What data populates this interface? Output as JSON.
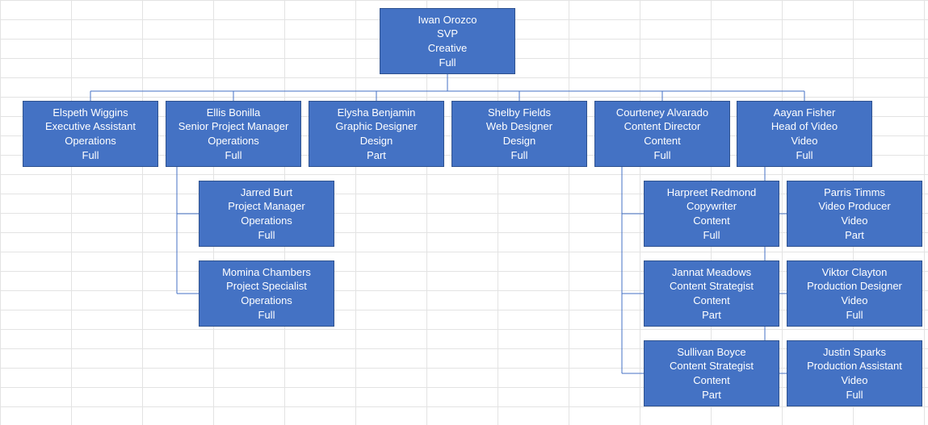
{
  "colors": {
    "node_fill": "#4472c4",
    "node_border": "#2f528f",
    "text": "#ffffff",
    "grid": "#e3e3e3"
  },
  "root": {
    "name": "Iwan Orozco",
    "title": "SVP",
    "dept": "Creative",
    "status": "Full"
  },
  "row2": [
    {
      "name": "Elspeth Wiggins",
      "title": "Executive Assistant",
      "dept": "Operations",
      "status": "Full"
    },
    {
      "name": "Ellis Bonilla",
      "title": "Senior Project Manager",
      "dept": "Operations",
      "status": "Full"
    },
    {
      "name": "Elysha Benjamin",
      "title": "Graphic Designer",
      "dept": "Design",
      "status": "Part"
    },
    {
      "name": "Shelby Fields",
      "title": "Web Designer",
      "dept": "Design",
      "status": "Full"
    },
    {
      "name": "Courteney Alvarado",
      "title": "Content Director",
      "dept": "Content",
      "status": "Full"
    },
    {
      "name": "Aayan Fisher",
      "title": "Head of Video",
      "dept": "Video",
      "status": "Full"
    }
  ],
  "ellis_children": [
    {
      "name": "Jarred Burt",
      "title": "Project Manager",
      "dept": "Operations",
      "status": "Full"
    },
    {
      "name": "Momina Chambers",
      "title": "Project Specialist",
      "dept": "Operations",
      "status": "Full"
    }
  ],
  "courteney_children": [
    {
      "name": "Harpreet Redmond",
      "title": "Copywriter",
      "dept": "Content",
      "status": "Full"
    },
    {
      "name": "Jannat Meadows",
      "title": "Content Strategist",
      "dept": "Content",
      "status": "Part"
    },
    {
      "name": "Sullivan Boyce",
      "title": "Content Strategist",
      "dept": "Content",
      "status": "Part"
    }
  ],
  "aayan_children": [
    {
      "name": "Parris Timms",
      "title": "Video Producer",
      "dept": "Video",
      "status": "Part"
    },
    {
      "name": "Viktor Clayton",
      "title": "Production Designer",
      "dept": "Video",
      "status": "Full"
    },
    {
      "name": "Justin Sparks",
      "title": "Production Assistant",
      "dept": "Video",
      "status": "Full"
    }
  ],
  "chart_data": {
    "type": "tree",
    "title": "",
    "root": {
      "name": "Iwan Orozco",
      "title": "SVP",
      "dept": "Creative",
      "status": "Full",
      "children": [
        {
          "name": "Elspeth Wiggins",
          "title": "Executive Assistant",
          "dept": "Operations",
          "status": "Full",
          "children": []
        },
        {
          "name": "Ellis Bonilla",
          "title": "Senior Project Manager",
          "dept": "Operations",
          "status": "Full",
          "children": [
            {
              "name": "Jarred Burt",
              "title": "Project Manager",
              "dept": "Operations",
              "status": "Full",
              "children": []
            },
            {
              "name": "Momina Chambers",
              "title": "Project Specialist",
              "dept": "Operations",
              "status": "Full",
              "children": []
            }
          ]
        },
        {
          "name": "Elysha Benjamin",
          "title": "Graphic Designer",
          "dept": "Design",
          "status": "Part",
          "children": []
        },
        {
          "name": "Shelby Fields",
          "title": "Web Designer",
          "dept": "Design",
          "status": "Full",
          "children": []
        },
        {
          "name": "Courteney Alvarado",
          "title": "Content Director",
          "dept": "Content",
          "status": "Full",
          "children": [
            {
              "name": "Harpreet Redmond",
              "title": "Copywriter",
              "dept": "Content",
              "status": "Full",
              "children": []
            },
            {
              "name": "Jannat Meadows",
              "title": "Content Strategist",
              "dept": "Content",
              "status": "Part",
              "children": []
            },
            {
              "name": "Sullivan Boyce",
              "title": "Content Strategist",
              "dept": "Content",
              "status": "Part",
              "children": []
            }
          ]
        },
        {
          "name": "Aayan Fisher",
          "title": "Head of Video",
          "dept": "Video",
          "status": "Full",
          "children": [
            {
              "name": "Parris Timms",
              "title": "Video Producer",
              "dept": "Video",
              "status": "Part",
              "children": []
            },
            {
              "name": "Viktor Clayton",
              "title": "Production Designer",
              "dept": "Video",
              "status": "Full",
              "children": []
            },
            {
              "name": "Justin Sparks",
              "title": "Production Assistant",
              "dept": "Video",
              "status": "Full",
              "children": []
            }
          ]
        }
      ]
    }
  }
}
